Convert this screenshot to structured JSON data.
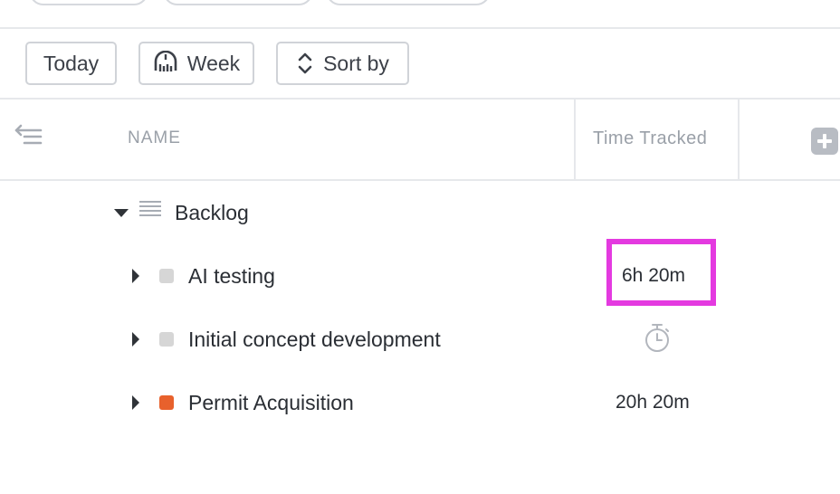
{
  "toolbar": {
    "today_label": "Today",
    "week_label": "Week",
    "sort_label": "Sort by"
  },
  "header": {
    "name_col": "NAME",
    "time_col": "Time Tracked"
  },
  "group": {
    "name": "Backlog"
  },
  "tasks": [
    {
      "name": "AI testing",
      "time_tracked": "6h 20m",
      "status_color": "#d6d6d6",
      "highlighted": true
    },
    {
      "name": "Initial concept development",
      "time_tracked": "",
      "status_color": "#d6d6d6",
      "icon": "timer-icon"
    },
    {
      "name": "Permit Acquisition",
      "time_tracked": "20h 20m",
      "status_color": "#e8612c"
    }
  ],
  "colors": {
    "highlight": "#e43ae0",
    "muted_text": "#9aa0a8"
  }
}
